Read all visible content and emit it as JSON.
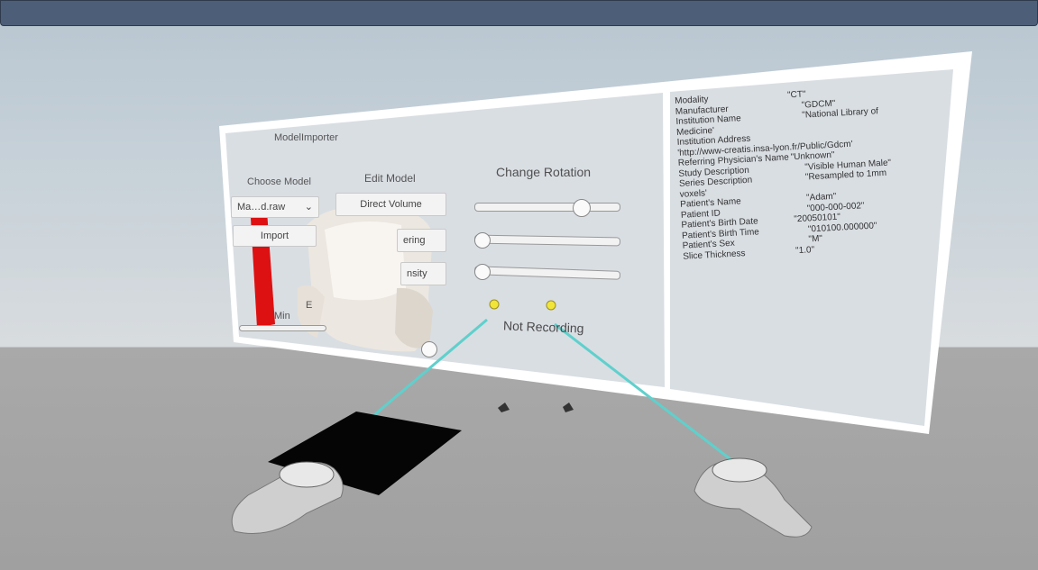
{
  "importer": {
    "title": "ModelImporter",
    "choose_model_label": "Choose Model",
    "model_select_value": "Ma…d.raw",
    "import_button": "Import",
    "min_label": "Min",
    "e_label": "E"
  },
  "edit_model": {
    "label": "Edit Model",
    "buttons": [
      "Direct Volume",
      "Rendering",
      "Isosurface Density"
    ],
    "visible_button_text": [
      "Direct Volume",
      "ering",
      "nsity"
    ]
  },
  "rotation": {
    "label": "Change Rotation",
    "sliders": [
      {
        "name": "rotation-slider-1",
        "value": 0.8
      },
      {
        "name": "rotation-slider-2",
        "value": 0.0
      },
      {
        "name": "rotation-slider-3",
        "value": 0.0
      }
    ]
  },
  "recording": {
    "status": "Not Recording"
  },
  "dicom": {
    "rows": [
      {
        "key": "Modality",
        "value": "\"CT\""
      },
      {
        "key": "Manufacturer",
        "value": "\"GDCM\""
      },
      {
        "key": "Institution Name",
        "value": "\"National Library of"
      },
      {
        "key": "Medicine'",
        "value": ""
      },
      {
        "key": "Institution Address",
        "value": ""
      },
      {
        "key": "'http://www-creatis.insa-lyon.fr/Public/Gdcm'",
        "value": ""
      },
      {
        "key": "Referring Physician's Name",
        "value": "\"Unknown\""
      },
      {
        "key": "Study Description",
        "value": "\"Visible Human Male\""
      },
      {
        "key": "Series Description",
        "value": "\"Resampled to 1mm"
      },
      {
        "key": "voxels'",
        "value": ""
      },
      {
        "key": "Patient's Name",
        "value": "\"Adam\""
      },
      {
        "key": "Patient ID",
        "value": "\"000-000-002\""
      },
      {
        "key": "Patient's Birth Date",
        "value": "\"20050101\""
      },
      {
        "key": "Patient's Birth Time",
        "value": "\"010100.000000\""
      },
      {
        "key": "Patient's Sex",
        "value": "\"M\""
      },
      {
        "key": "Slice Thickness",
        "value": "\"1.0\""
      }
    ]
  },
  "colors": {
    "topbar": "#4d5e78",
    "panel": "#dadfe3",
    "panel_border": "#ffffff",
    "laser": "#5fd0cc",
    "red_bar": "#dd1111",
    "indicator": "#f2e53a"
  }
}
